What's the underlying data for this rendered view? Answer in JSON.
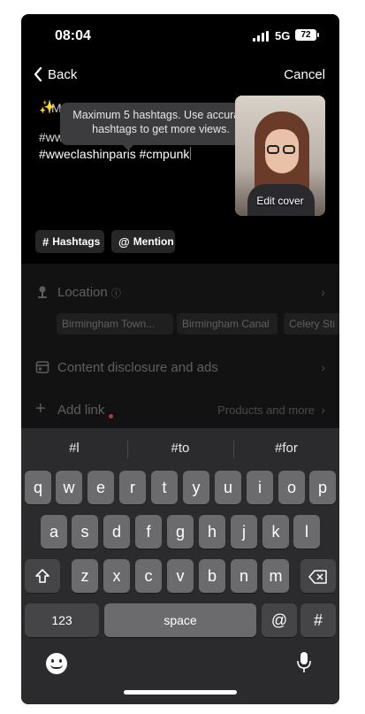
{
  "status": {
    "time": "08:04",
    "network": "5G",
    "battery": "72"
  },
  "nav": {
    "back_label": "Back",
    "cancel_label": "Cancel"
  },
  "caption": {
    "ghost": "M",
    "line1": "#ww",
    "line2": "#wweclashinparis #cmpunk"
  },
  "tooltip": {
    "text": "Maximum 5 hashtags. Use accurate hashtags to get more views."
  },
  "cover": {
    "edit_label": "Edit cover"
  },
  "chips": {
    "hashtags": "Hashtags",
    "mention": "Mention",
    "hash_sym": "#",
    "at_sym": "@"
  },
  "location": {
    "label": "Location",
    "info": "ⓘ",
    "tags": [
      "Birmingham Town...",
      "Birmingham Canal",
      "Celery Sti"
    ]
  },
  "disclosure": {
    "label": "Content disclosure and ads"
  },
  "addlink": {
    "label": "Add link",
    "right": "Products and more"
  },
  "keyboard": {
    "suggestions": [
      "#l",
      "#to",
      "#for"
    ],
    "row1": [
      "q",
      "w",
      "e",
      "r",
      "t",
      "y",
      "u",
      "i",
      "o",
      "p"
    ],
    "row2": [
      "a",
      "s",
      "d",
      "f",
      "g",
      "h",
      "j",
      "k",
      "l"
    ],
    "row3": [
      "z",
      "x",
      "c",
      "v",
      "b",
      "n",
      "m"
    ],
    "numbers_key": "123",
    "space_key": "space",
    "at_key": "@",
    "hash_key": "#"
  }
}
